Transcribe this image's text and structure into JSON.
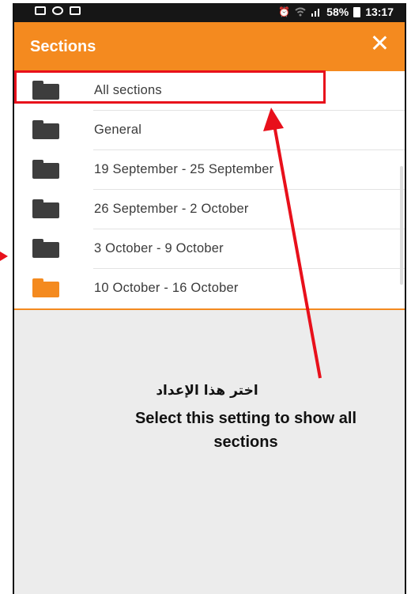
{
  "status_bar": {
    "battery_text": "58%",
    "time": "13:17",
    "left_icons": [
      "image-icon",
      "circle-icon",
      "square-icon"
    ],
    "right_icons": [
      "alarm-icon",
      "wifi-icon",
      "signal-icon",
      "battery-icon"
    ]
  },
  "app_bar": {
    "title": "Sections",
    "close_icon": "close-icon",
    "color": "#f48a1f"
  },
  "sections": [
    {
      "label": "All sections",
      "icon": "folder-icon",
      "icon_color": "#3d3d3d"
    },
    {
      "label": "General",
      "icon": "folder-icon",
      "icon_color": "#3d3d3d"
    },
    {
      "label": "19 September - 25 September",
      "icon": "folder-icon",
      "icon_color": "#3d3d3d"
    },
    {
      "label": "26 September - 2 October",
      "icon": "folder-icon",
      "icon_color": "#3d3d3d"
    },
    {
      "label": "3 October - 9 October",
      "icon": "folder-icon",
      "icon_color": "#3d3d3d"
    },
    {
      "label": "10 October - 16 October",
      "icon": "folder-icon",
      "icon_color": "#f48a1f"
    }
  ],
  "annotation": {
    "arabic": "اختر هذا الإعداد",
    "english": "Select this setting to show all sections",
    "color": "#e8101b"
  }
}
